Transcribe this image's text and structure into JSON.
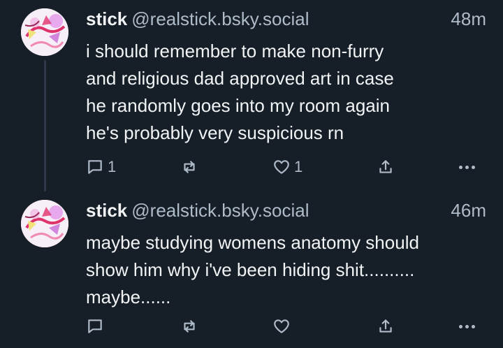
{
  "posts": [
    {
      "display_name": "stick",
      "handle": "@realstick.bsky.social",
      "time": "48m",
      "text": "i should remember to make non-furry\nand religious dad approved art in case\nhe randomly goes into my room again\nhe's probably very suspicious rn",
      "reply_count": "1",
      "repost_count": "",
      "like_count": "1",
      "icons": [
        "avatar",
        "reply-icon",
        "repost-icon",
        "like-icon",
        "share-icon",
        "more-icon"
      ]
    },
    {
      "display_name": "stick",
      "handle": "@realstick.bsky.social",
      "time": "46m",
      "text": "maybe studying womens anatomy should\nshow him why i've been hiding shit..........\nmaybe......",
      "reply_count": "",
      "repost_count": "",
      "like_count": "",
      "icons": [
        "avatar",
        "reply-icon",
        "repost-icon",
        "like-icon",
        "share-icon",
        "more-icon"
      ]
    }
  ],
  "colors": {
    "background": "#161e27",
    "text": "#f1f3f5",
    "muted": "#aebbc9",
    "thread_line": "#2e3a4b"
  }
}
